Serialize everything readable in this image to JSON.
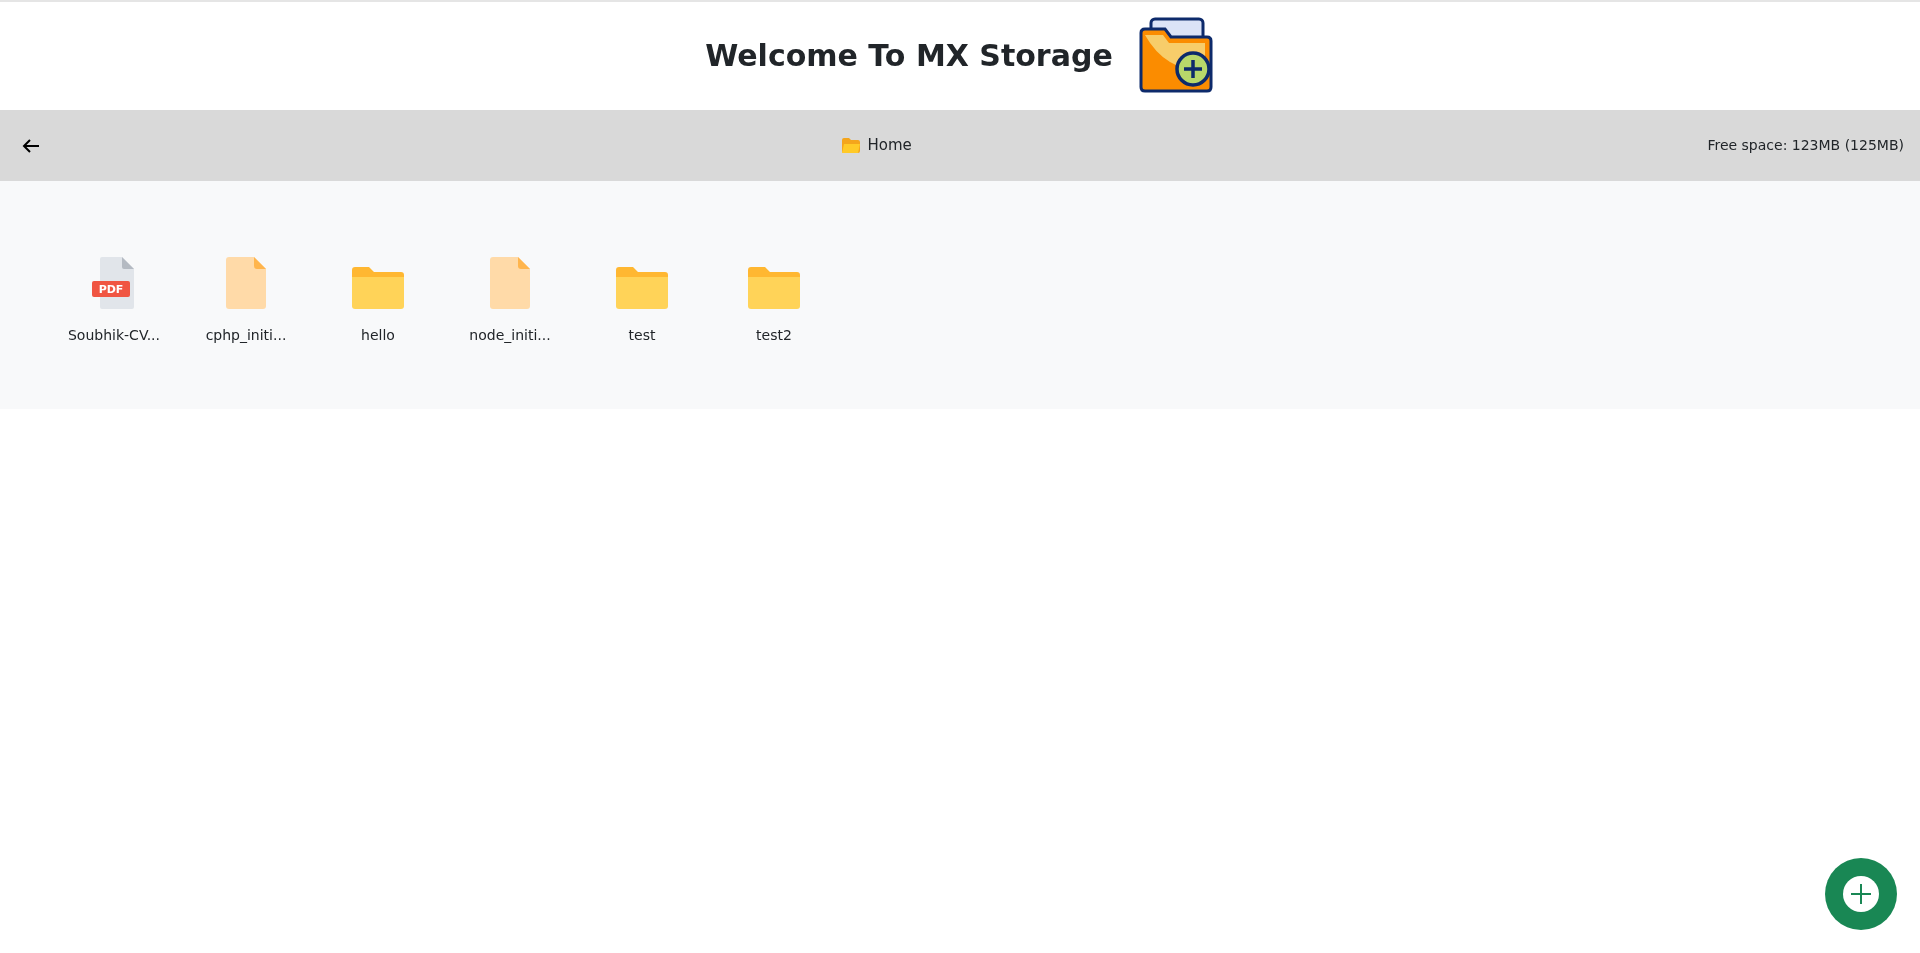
{
  "header": {
    "title": "Welcome To MX Storage"
  },
  "toolbar": {
    "location": "Home",
    "free_space": "Free space: 123MB (125MB)"
  },
  "items": [
    {
      "kind": "pdf",
      "badge": "PDF",
      "name": "Soubhik-CV..."
    },
    {
      "kind": "file",
      "name": "cphp_initi..."
    },
    {
      "kind": "folder",
      "name": "hello"
    },
    {
      "kind": "file",
      "name": "node_initi..."
    },
    {
      "kind": "folder",
      "name": "test"
    },
    {
      "kind": "folder",
      "name": "test2"
    }
  ]
}
